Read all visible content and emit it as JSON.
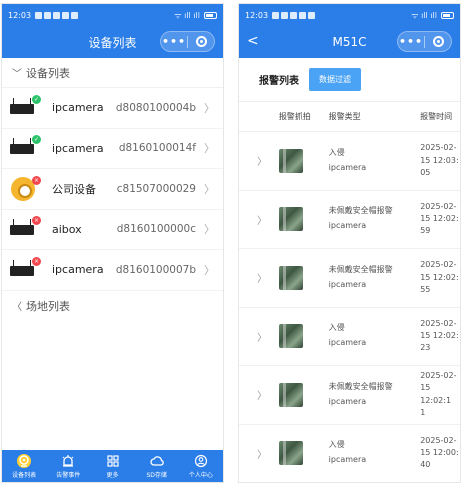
{
  "left": {
    "status": {
      "time": "12:03"
    },
    "nav": {
      "title": "设备列表",
      "more": "•••"
    },
    "section_devices": "设备列表",
    "devices": [
      {
        "name": "ipcamera",
        "id": "d8080100004b",
        "status": "online",
        "icon": "nvr-icon"
      },
      {
        "name": "ipcamera",
        "id": "d8160100014f",
        "status": "online",
        "icon": "nvr-icon"
      },
      {
        "name": "公司设备",
        "id": "c81507000029",
        "status": "offline",
        "icon": "camera-icon"
      },
      {
        "name": "aibox",
        "id": "d8160100000c",
        "status": "offline",
        "icon": "nvr-icon"
      },
      {
        "name": "ipcamera",
        "id": "d8160100007b",
        "status": "offline",
        "icon": "nvr-icon"
      }
    ],
    "section_sites": "场地列表",
    "tabs": [
      {
        "label": "设备列表",
        "icon": "camera-tab-icon",
        "active": true
      },
      {
        "label": "告警事件",
        "icon": "alarm-icon",
        "active": false
      },
      {
        "label": "更多",
        "icon": "grid-icon",
        "active": false
      },
      {
        "label": "SD存储",
        "icon": "cloud-icon",
        "active": false
      },
      {
        "label": "个人中心",
        "icon": "user-icon",
        "active": false
      }
    ],
    "colors": {
      "primary": "#2b7ee8",
      "online": "#2ec36b",
      "offline": "#f0484d"
    }
  },
  "right": {
    "status": {
      "time": "12:03"
    },
    "nav": {
      "title": "M51C",
      "back": "<",
      "more": "•••"
    },
    "alarm_title": "报警列表",
    "filter_label": "数据过滤",
    "columns": {
      "snapshot": "报警抓拍",
      "type": "报警类型",
      "time": "报警时间"
    },
    "alarms": [
      {
        "type": "入侵",
        "device": "ipcamera",
        "time": [
          "2025-02-",
          "15 12:03:",
          "05"
        ]
      },
      {
        "type": "未佩戴安全帽报警",
        "device": "ipcamera",
        "time": [
          "2025-02-",
          "15 12:02:",
          "59"
        ]
      },
      {
        "type": "未佩戴安全帽报警",
        "device": "ipcamera",
        "time": [
          "2025-02-",
          "15 12:02:",
          "55"
        ]
      },
      {
        "type": "入侵",
        "device": "ipcamera",
        "time": [
          "2025-02-",
          "15 12:02:",
          "23"
        ]
      },
      {
        "type": "未佩戴安全帽报警",
        "device": "ipcamera",
        "time": [
          "2025-02-",
          "15 12:02:1",
          "1"
        ]
      },
      {
        "type": "入侵",
        "device": "ipcamera",
        "time": [
          "2025-02-",
          "15 12:00:",
          "40"
        ]
      }
    ],
    "colors": {
      "filter_button": "#4aa3f5"
    }
  }
}
